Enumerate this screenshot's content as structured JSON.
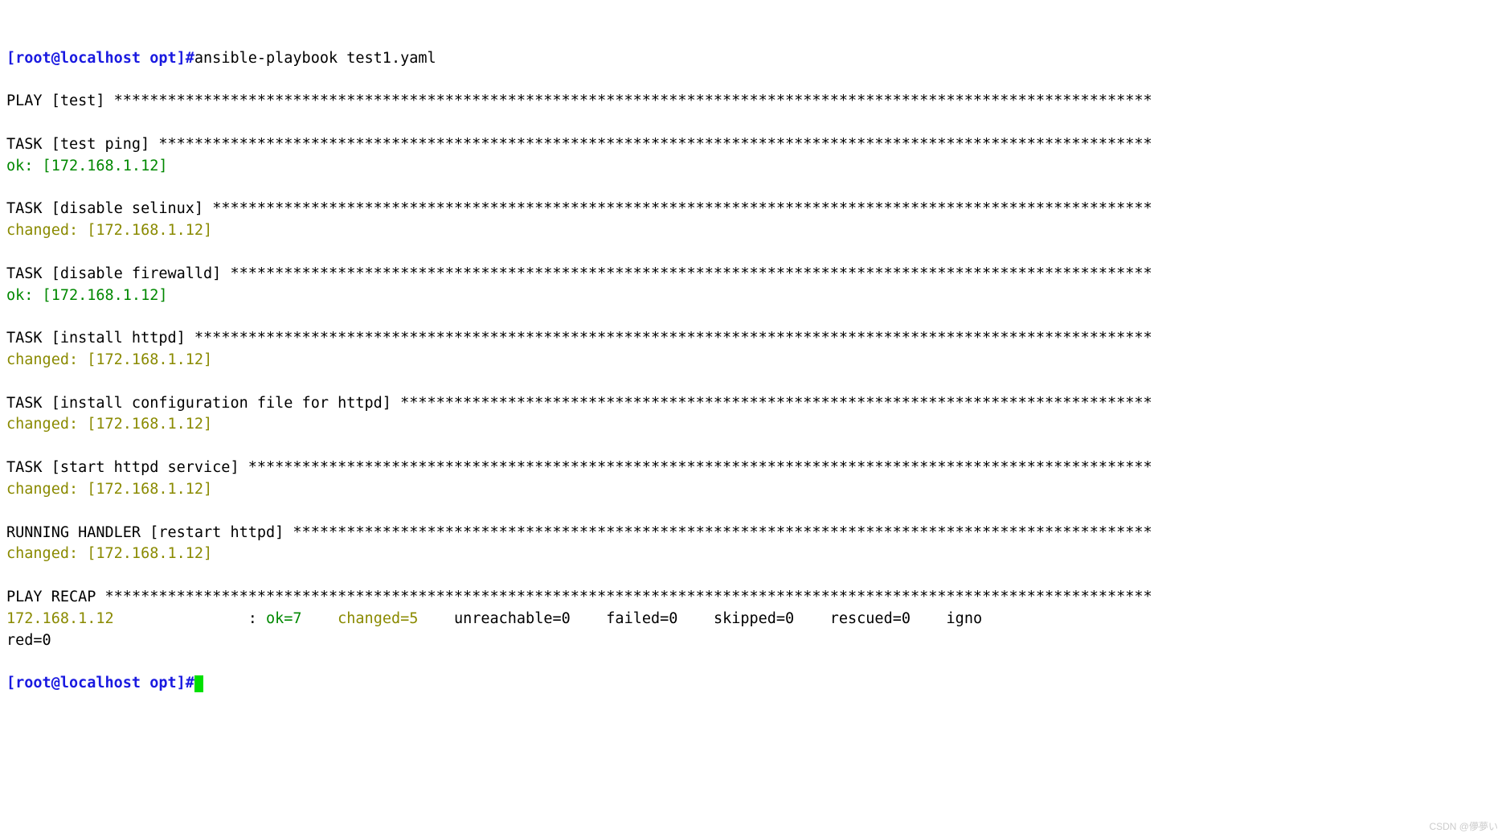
{
  "prompt": {
    "text": "[root@localhost opt]#",
    "command": "ansible-playbook test1.yaml"
  },
  "play_header": {
    "label": "PLAY [test] ",
    "stars": "********************************************************************************************************************"
  },
  "tasks": [
    {
      "header_label": "TASK [test ping] ",
      "header_stars": "***************************************************************************************************************",
      "status_class": "ok-green",
      "status_text": "ok: [172.168.1.12]"
    },
    {
      "header_label": "TASK [disable selinux] ",
      "header_stars": "*********************************************************************************************************",
      "status_class": "changed-olive",
      "status_text": "changed: [172.168.1.12]"
    },
    {
      "header_label": "TASK [disable firewalld] ",
      "header_stars": "*******************************************************************************************************",
      "status_class": "ok-green",
      "status_text": "ok: [172.168.1.12]"
    },
    {
      "header_label": "TASK [install httpd] ",
      "header_stars": "***********************************************************************************************************",
      "status_class": "changed-olive",
      "status_text": "changed: [172.168.1.12]"
    },
    {
      "header_label": "TASK [install configuration file for httpd] ",
      "header_stars": "************************************************************************************",
      "status_class": "changed-olive",
      "status_text": "changed: [172.168.1.12]"
    },
    {
      "header_label": "TASK [start httpd service] ",
      "header_stars": "*****************************************************************************************************",
      "status_class": "changed-olive",
      "status_text": "changed: [172.168.1.12]"
    },
    {
      "header_label": "RUNNING HANDLER [restart httpd] ",
      "header_stars": "************************************************************************************************",
      "status_class": "changed-olive",
      "status_text": "changed: [172.168.1.12]"
    }
  ],
  "recap": {
    "header_label": "PLAY RECAP ",
    "header_stars": "*********************************************************************************************************************",
    "host": "172.168.1.12",
    "host_pad": "               ",
    "colon": ": ",
    "ok": "ok=7",
    "sep1": "    ",
    "changed": "changed=5",
    "sep2": "    ",
    "rest_line": "unreachable=0    failed=0    skipped=0    rescued=0    igno",
    "wrap_line": "red=0"
  },
  "final_prompt": "[root@localhost opt]#",
  "watermark": "CSDN @儚夢い"
}
